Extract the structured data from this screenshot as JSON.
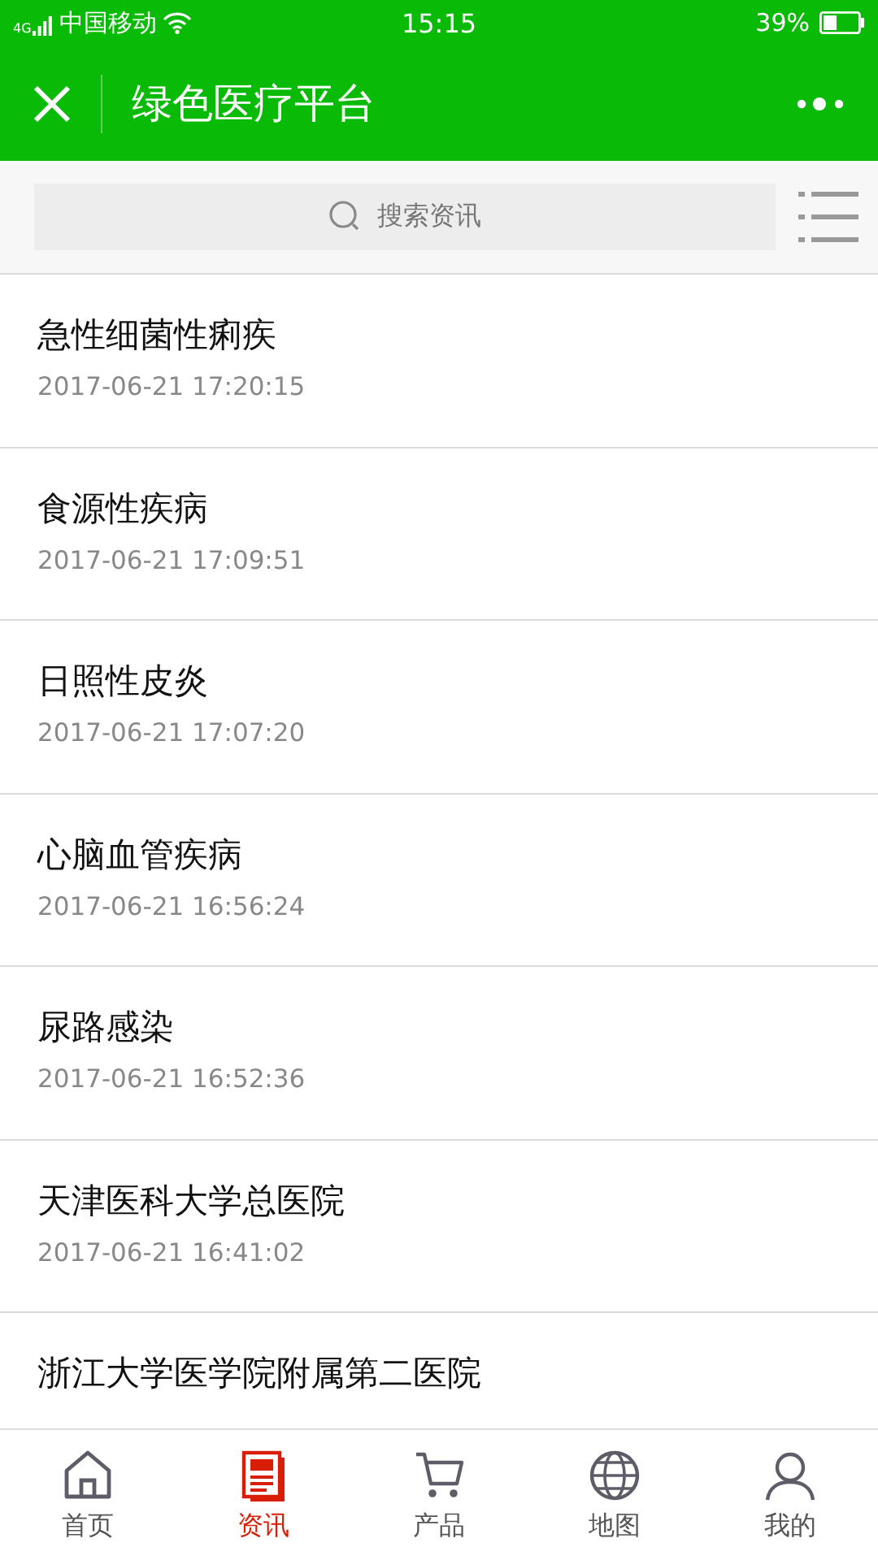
{
  "status_bar": {
    "network": "4G",
    "carrier": "中国移动",
    "time": "15:15",
    "battery": "39%"
  },
  "nav_bar": {
    "title": "绿色医疗平台"
  },
  "search": {
    "placeholder": "搜索资讯"
  },
  "news": [
    {
      "title": "急性细菌性痢疾",
      "time": "2017-06-21 17:20:15"
    },
    {
      "title": "食源性疾病",
      "time": "2017-06-21 17:09:51"
    },
    {
      "title": "日照性皮炎",
      "time": "2017-06-21 17:07:20"
    },
    {
      "title": "心脑血管疾病",
      "time": "2017-06-21 16:56:24"
    },
    {
      "title": "尿路感染",
      "time": "2017-06-21 16:52:36"
    },
    {
      "title": "天津医科大学总医院",
      "time": "2017-06-21 16:41:02"
    },
    {
      "title": "浙江大学医学院附属第二医院"
    }
  ],
  "tab_bar": [
    {
      "kind": "home",
      "label": "首页",
      "selected": false
    },
    {
      "kind": "news",
      "label": "资讯",
      "selected": true
    },
    {
      "kind": "cart",
      "label": "产品",
      "selected": false
    },
    {
      "kind": "globe",
      "label": "地图",
      "selected": false
    },
    {
      "kind": "user",
      "label": "我的",
      "selected": false
    }
  ]
}
